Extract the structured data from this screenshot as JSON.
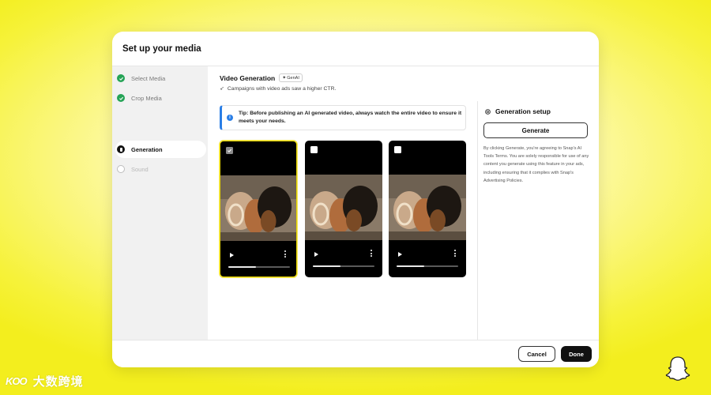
{
  "modal": {
    "title": "Set up your media"
  },
  "sidebar": {
    "steps": [
      {
        "label": "Select Media",
        "status": "done"
      },
      {
        "label": "Crop Media",
        "status": "done"
      },
      {
        "label": "Generation",
        "status": "active"
      },
      {
        "label": "Sound",
        "status": "pending"
      }
    ]
  },
  "main": {
    "title": "Video Generation",
    "badge": "GenAI",
    "subtitle": "Campaigns with video ads saw a higher CTR.",
    "tip": "Tip: Before publishing an AI generated video, always watch the entire video to ensure it meets your needs.",
    "videos": [
      {
        "selected": true,
        "progress": 0.45
      },
      {
        "selected": false,
        "progress": 0.45
      },
      {
        "selected": false,
        "progress": 0.45
      }
    ]
  },
  "setup": {
    "title": "Generation setup",
    "generate_label": "Generate",
    "disclaimer": "By clicking Generate, you're agreeing to Snap's AI Tools Terms. You are solely responsible for use of any content you generate using this feature in your ads, including ensuring that it complies with Snap's Advertising Policies."
  },
  "footer": {
    "cancel_label": "Cancel",
    "done_label": "Done"
  },
  "watermark": {
    "logo": "KOO",
    "text": "大数跨境"
  },
  "colors": {
    "accent_yellow": "#fffc00",
    "success": "#25a356",
    "info": "#2a7ee6",
    "primary_button": "#111111"
  }
}
